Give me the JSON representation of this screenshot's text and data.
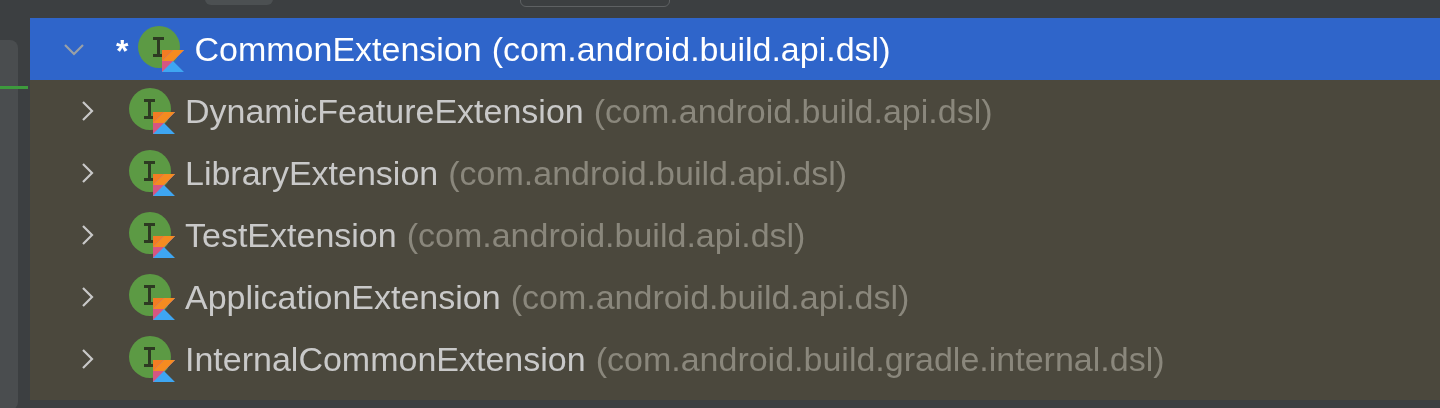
{
  "tree": [
    {
      "name": "CommonExtension",
      "package": "(com.android.build.api.dsl)",
      "marker": "*",
      "expanded": true,
      "selected": true,
      "children": [
        {
          "name": "DynamicFeatureExtension",
          "package": "(com.android.build.api.dsl)",
          "expanded": false,
          "selected": false
        },
        {
          "name": "LibraryExtension",
          "package": "(com.android.build.api.dsl)",
          "expanded": false,
          "selected": false
        },
        {
          "name": "TestExtension",
          "package": "(com.android.build.api.dsl)",
          "expanded": false,
          "selected": false
        },
        {
          "name": "ApplicationExtension",
          "package": "(com.android.build.api.dsl)",
          "expanded": false,
          "selected": false
        },
        {
          "name": "InternalCommonExtension",
          "package": "(com.android.build.gradle.internal.dsl)",
          "expanded": false,
          "selected": false
        }
      ]
    }
  ]
}
